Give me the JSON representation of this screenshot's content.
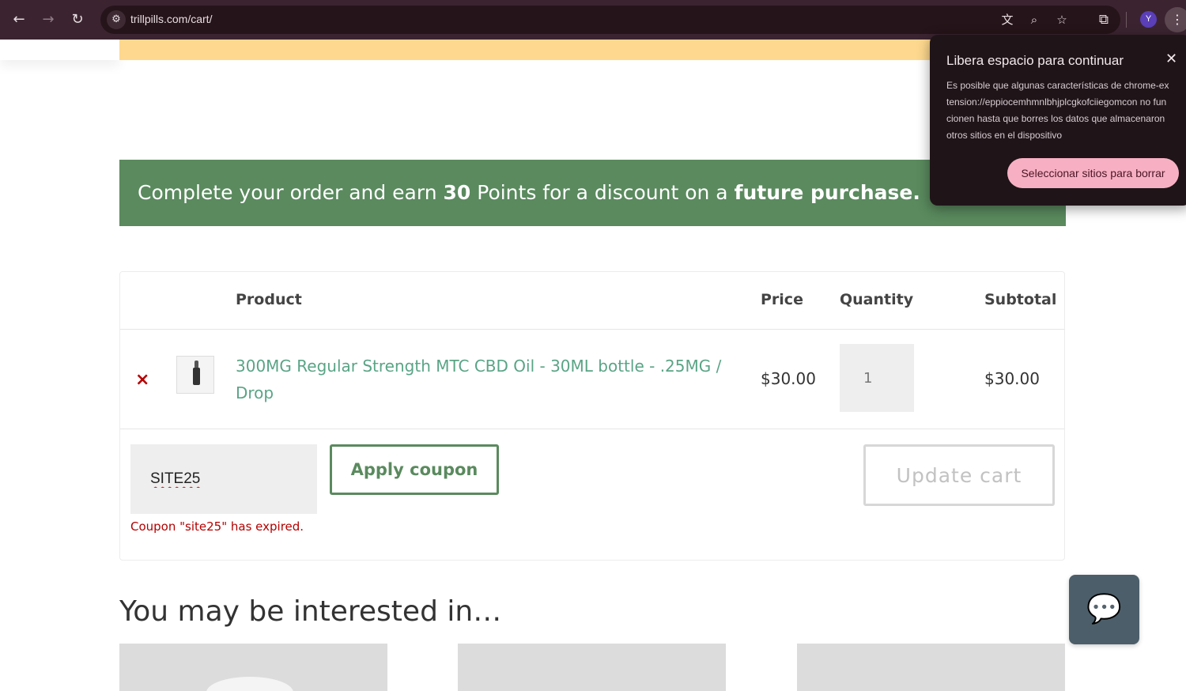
{
  "browser": {
    "url": "trillpills.com/cart/",
    "avatar_initial": "Y"
  },
  "points_banner": {
    "prefix": "Complete your order and earn ",
    "points": "30",
    "middle": " Points for a discount on a ",
    "emphasis": "future purchase."
  },
  "cart": {
    "headers": {
      "product": "Product",
      "price": "Price",
      "quantity": "Quantity",
      "subtotal": "Subtotal"
    },
    "items": [
      {
        "remove": "×",
        "name": "300MG Regular Strength MTC CBD Oil - 30ML bottle - .25MG / Drop",
        "price": "$30.00",
        "quantity": "1",
        "subtotal": "$30.00"
      }
    ],
    "coupon": {
      "value": "SITE25",
      "apply_label": "Apply coupon",
      "error": "Coupon \"site25\" has expired."
    },
    "update_label": "Update cart"
  },
  "related": {
    "heading": "You may be interested in…"
  },
  "popup": {
    "title": "Libera espacio para continuar",
    "body": "Es posible que algunas características de chrome-extension://eppiocemhmnlbhjplcgkofciiegomcon no funcionen hasta que borres los datos que almacenaron otros sitios en el dispositivo",
    "action": "Seleccionar sitios para borrar"
  },
  "colors": {
    "banner_green": "#5a8a5e",
    "link_green": "#5aa486",
    "error_red": "#b30000",
    "yellow_bar": "#fdd88e"
  }
}
